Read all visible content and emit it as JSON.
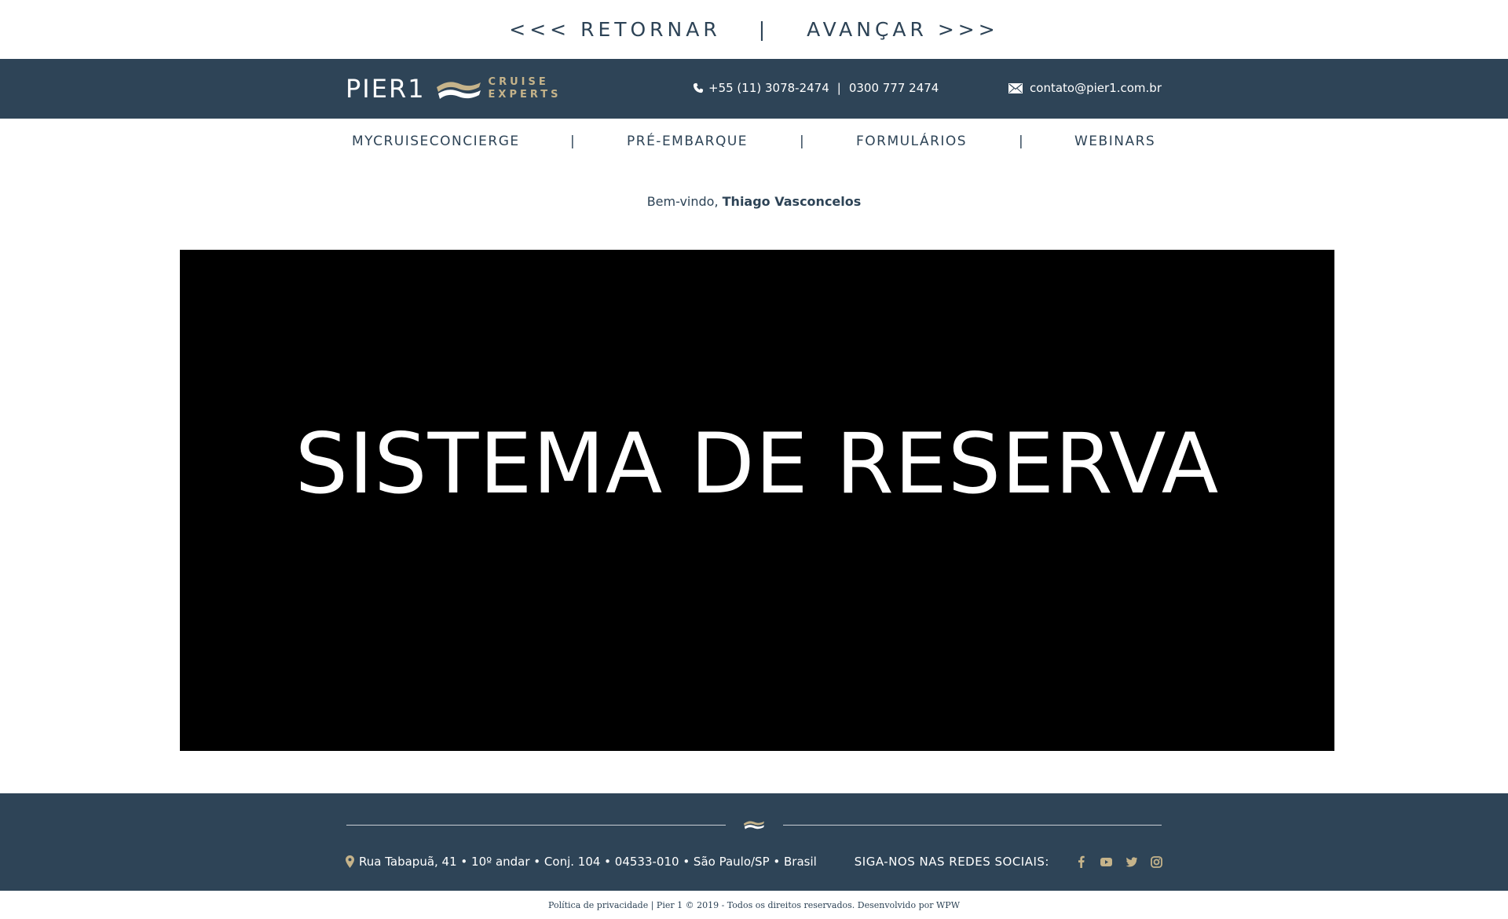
{
  "pager": {
    "back_label": "<<< RETORNAR",
    "separator": "|",
    "forward_label": "AVANÇAR >>>"
  },
  "header": {
    "logo_text": "PIER1",
    "logo_tagline_1": "CRUISE",
    "logo_tagline_2": "EXPERTS",
    "phone_1": "+55 (11) 3078-2474",
    "phone_separator": "|",
    "phone_2": "0300 777 2474",
    "email": "contato@pier1.com.br"
  },
  "nav": {
    "items": [
      {
        "label": "MYCRUISECONCIERGE"
      },
      {
        "label": "PRÉ-EMBARQUE"
      },
      {
        "label": "FORMULÁRIOS"
      },
      {
        "label": "WEBINARS"
      }
    ],
    "separator": "|"
  },
  "welcome": {
    "prefix": "Bem-vindo,",
    "user_name": "Thiago Vasconcelos"
  },
  "banner": {
    "title": "SISTEMA DE RESERVA"
  },
  "footer": {
    "address": "Rua Tabapuã, 41 • 10º andar • Conj. 104 • 04533-010 • São Paulo/SP • Brasil",
    "social_label": "SIGA-NOS NAS REDES SOCIAIS:",
    "social_icons": [
      "facebook-icon",
      "youtube-icon",
      "twitter-icon",
      "instagram-icon"
    ],
    "copyright": "Política de privacidade | Pier 1 © 2019 - Todos os direitos reservados. Desenvolvido por WPW"
  },
  "colors": {
    "navy": "#2e4457",
    "gold": "#c5b38a",
    "text": "#2d4356",
    "banner_bg": "#000000"
  }
}
